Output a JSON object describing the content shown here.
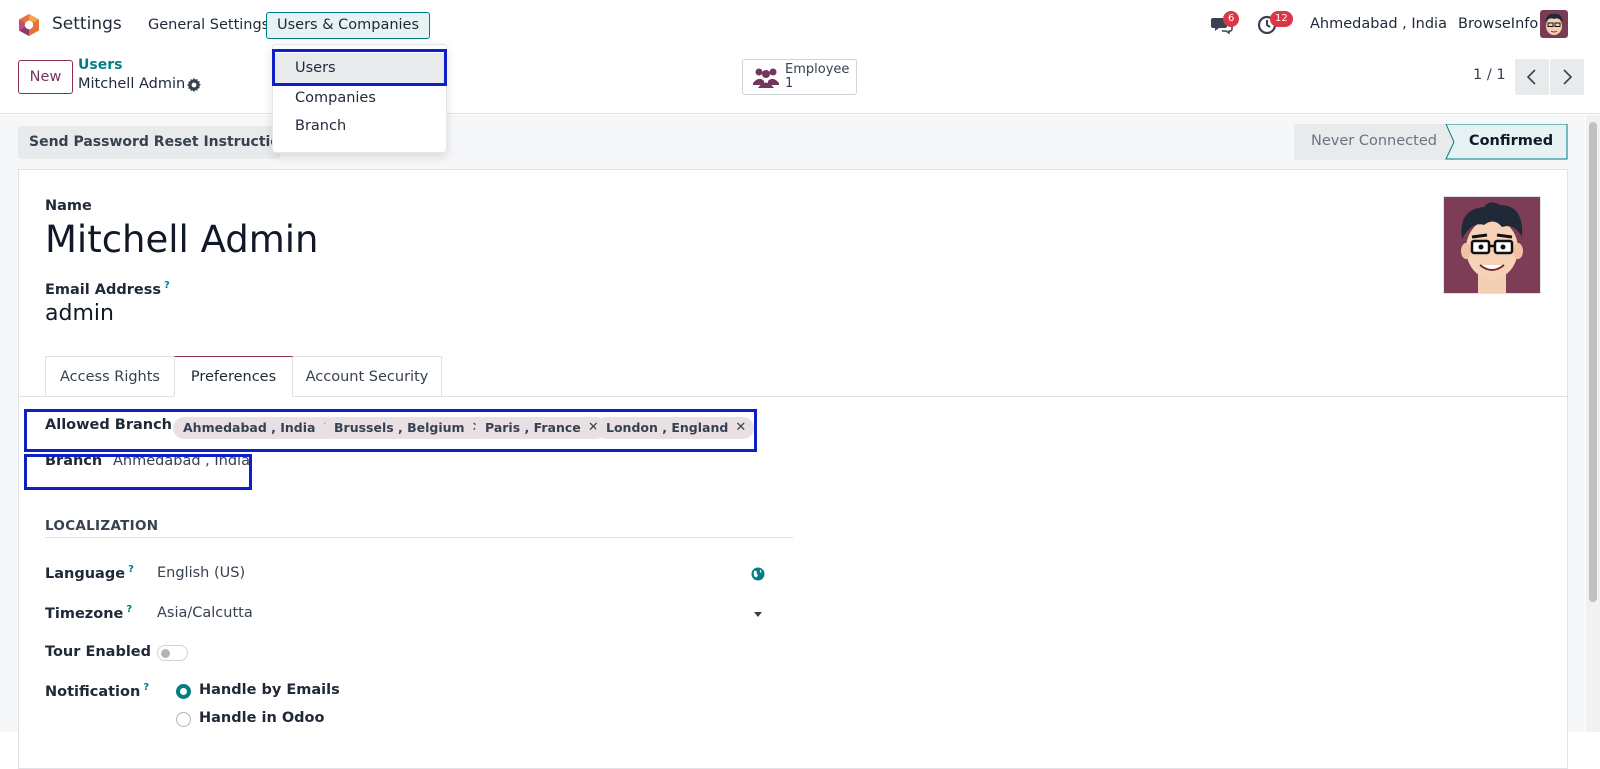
{
  "app": {
    "name": "Settings"
  },
  "menu": {
    "general": "General Settings",
    "users_companies": "Users & Companies"
  },
  "dropdown": {
    "items": [
      "Users",
      "Companies",
      "Branch"
    ]
  },
  "systray": {
    "messages_count": "6",
    "activities_count": "12",
    "branch": "Ahmedabad , India",
    "company": "BrowseInfo"
  },
  "control": {
    "new_label": "New",
    "breadcrumb_parent": "Users",
    "breadcrumb_current": "Mitchell Admin",
    "smart_label": "Employee",
    "smart_value": "1",
    "pager": "1 / 1"
  },
  "header": {
    "reset_button": "Send Password Reset Instructions",
    "status": [
      "Never Connected",
      "Confirmed"
    ],
    "status_active": "Confirmed"
  },
  "form": {
    "name_label": "Name",
    "name_value": "Mitchell Admin",
    "email_label": "Email Address",
    "email_help": "?",
    "email_value": "admin",
    "tabs": [
      "Access Rights",
      "Preferences",
      "Account Security"
    ],
    "active_tab": "Preferences",
    "allowed_branch_label": "Allowed Branch",
    "allowed_branches": [
      "Ahmedabad , India",
      "Brussels , Belgium",
      "Paris , France",
      "London , England"
    ],
    "tag_remove": "✕",
    "branch_label": "Branch",
    "branch_value": "Ahmedabad , India",
    "localization_title": "LOCALIZATION",
    "language_label": "Language",
    "language_value": "English (US)",
    "timezone_label": "Timezone",
    "timezone_value": "Asia/Calcutta",
    "tour_label": "Tour Enabled",
    "tour_enabled": false,
    "notification_label": "Notification",
    "notification_options": [
      "Handle by Emails",
      "Handle in Odoo"
    ],
    "notification_selected": "Handle by Emails"
  },
  "colors": {
    "accent": "#017e84",
    "brand": "#71385b",
    "highlight_box": "#0f1fc6",
    "badge": "#dc3545"
  }
}
